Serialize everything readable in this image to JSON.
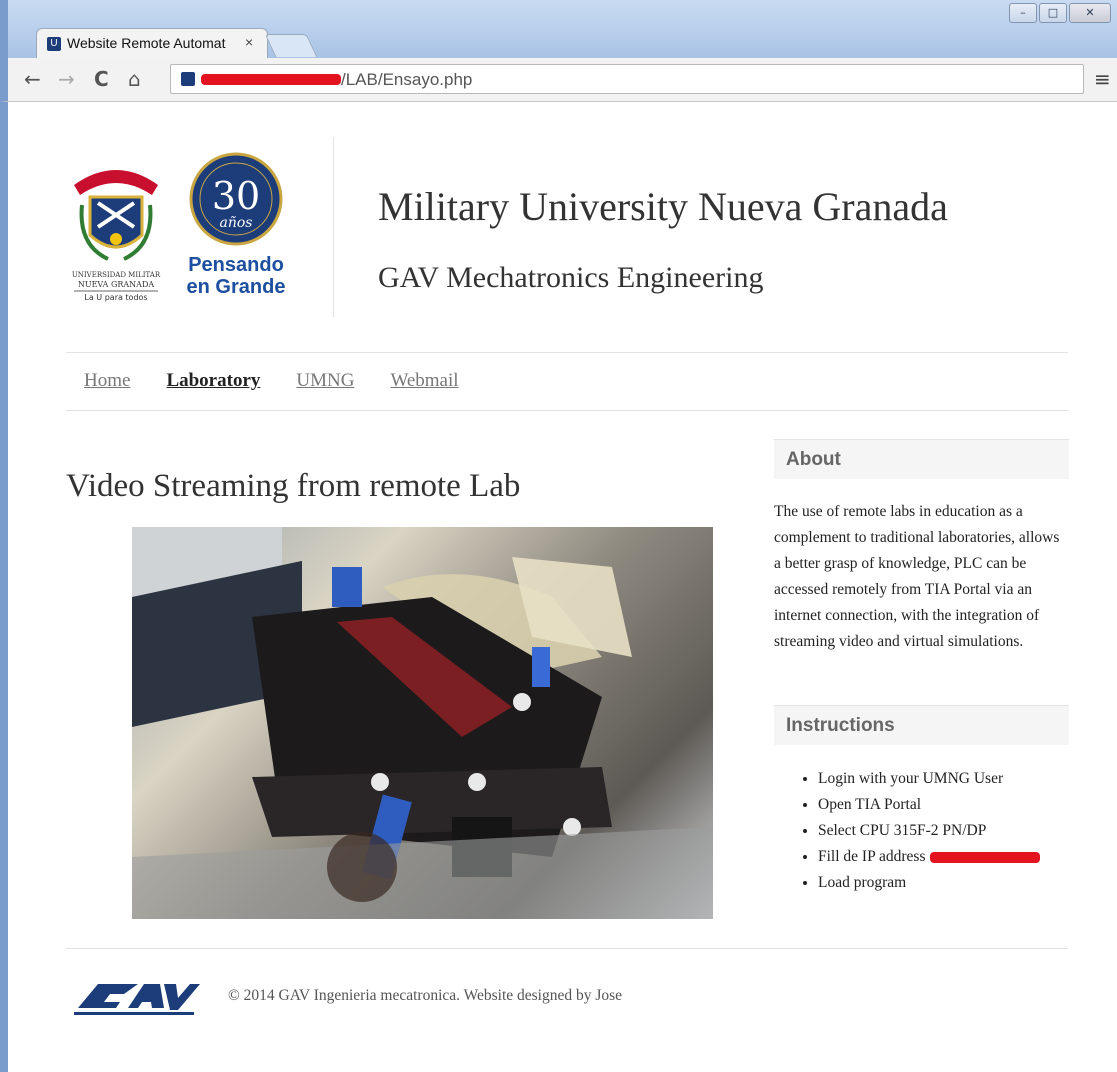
{
  "browser": {
    "tab_title": "Website Remote Automat",
    "tab_close": "×",
    "url_path": "/LAB/Ensayo.php",
    "back": "←",
    "forward": "→",
    "reload": "C",
    "home": "⌂",
    "menu": "≡",
    "minimize": "–",
    "maximize": "□",
    "close": "✕"
  },
  "header": {
    "title": "Military University Nueva Granada",
    "subtitle": "GAV Mechatronics Engineering",
    "logo_umng_lines": [
      "UNIVERSIDAD MILITAR",
      "NUEVA GRANADA",
      "La U para todos"
    ],
    "logo_30_number": "30",
    "logo_30_word": "años",
    "logo_30_tagline_1": "Pensando",
    "logo_30_tagline_2": "en Grande"
  },
  "nav": {
    "items": [
      {
        "label": "Home"
      },
      {
        "label": "Laboratory"
      },
      {
        "label": "UMNG"
      },
      {
        "label": "Webmail"
      }
    ],
    "active_index": 1
  },
  "main": {
    "heading": "Video Streaming from remote Lab"
  },
  "sidebar": {
    "about_title": "About",
    "about_text": "The use of remote labs in education as a complement to traditional laboratories, allows a better grasp of knowledge, PLC can be accessed remotely from TIA Portal via an internet connection, with the integration of streaming video and virtual simulations.",
    "instructions_title": "Instructions",
    "instructions": [
      "Login with your UMNG User",
      "Open TIA Portal",
      "Select CPU 315F-2 PN/DP",
      "Fill de IP address",
      "Load program"
    ]
  },
  "footer": {
    "text": "© 2014 GAV Ingenieria mecatronica. Website designed by Jose",
    "logo_text": "GAV"
  },
  "colors": {
    "chrome_blue": "#a9c3e6",
    "redaction": "#e3141f",
    "link_gray": "#777777",
    "umng_navy": "#1d3c7a"
  }
}
